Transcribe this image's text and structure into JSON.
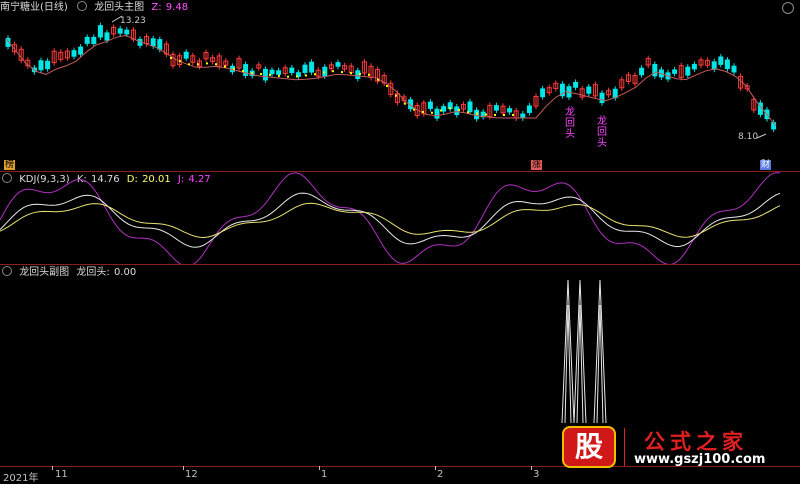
{
  "main": {
    "title": "南宁糖业(日线)",
    "indicator": "龙回头主图",
    "z_label": "Z:",
    "z_value": "9.48",
    "high_label": "13.23",
    "low_label": "8.10",
    "signal_text": "龙回头",
    "tag_left": "榜",
    "tag_mid": "涨",
    "tag_right": "财",
    "dot_color": "#ffff00",
    "up_color": "#ff3b3b",
    "down_color": "#00e5e5"
  },
  "kdj": {
    "name": "KDJ(9,3,3)",
    "k_label": "K:",
    "k_value": "14.76",
    "d_label": "D:",
    "d_value": "20.01",
    "j_label": "J:",
    "j_value": "4.27"
  },
  "sub": {
    "name": "龙回头副图",
    "label": "龙回头:",
    "value": "0.00"
  },
  "axis": {
    "year": "2021年",
    "months": [
      "11",
      "12",
      "1",
      "2",
      "3"
    ]
  },
  "watermark": {
    "logo_text": "股",
    "title": "公式之家",
    "url": "www.gszj100.com"
  }
}
